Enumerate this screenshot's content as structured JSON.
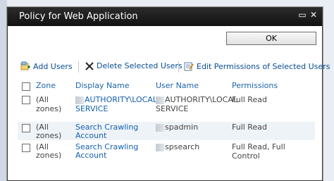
{
  "dialog": {
    "title": "Policy for Web Application",
    "ok_label": "OK",
    "minimize_glyph": "▭",
    "close_glyph": "✕"
  },
  "toolbar": {
    "add_users": "Add Users",
    "delete_users": "Delete Selected Users",
    "edit_permissions": "Edit Permissions of Selected Users"
  },
  "table": {
    "headers": {
      "zone": "Zone",
      "display_name": "Display Name",
      "user_name": "User Name",
      "permissions": "Permissions"
    },
    "rows": [
      {
        "zone_1": "(All",
        "zone_2": "zones)",
        "display_1": "AUTHORITY\\LOCAL",
        "display_2": "SERVICE",
        "user_1": "AUTHORITY\\LOCAL",
        "user_2": "SERVICE",
        "permissions": "Full Read"
      },
      {
        "zone_1": "(All",
        "zone_2": "zones)",
        "display_1": "Search Crawling",
        "display_2": "Account",
        "user_1": "spadmin",
        "user_2": "",
        "permissions": "Full Read"
      },
      {
        "zone_1": "(All",
        "zone_2": "zones)",
        "display_1": "Search Crawling",
        "display_2": "Account",
        "user_1": "spsearch",
        "user_2": "",
        "permissions": "Full Read, Full Control"
      }
    ]
  },
  "colors": {
    "titlebar": "#1a1a1a",
    "link": "#1360ad",
    "header_text": "#1d64aa"
  }
}
